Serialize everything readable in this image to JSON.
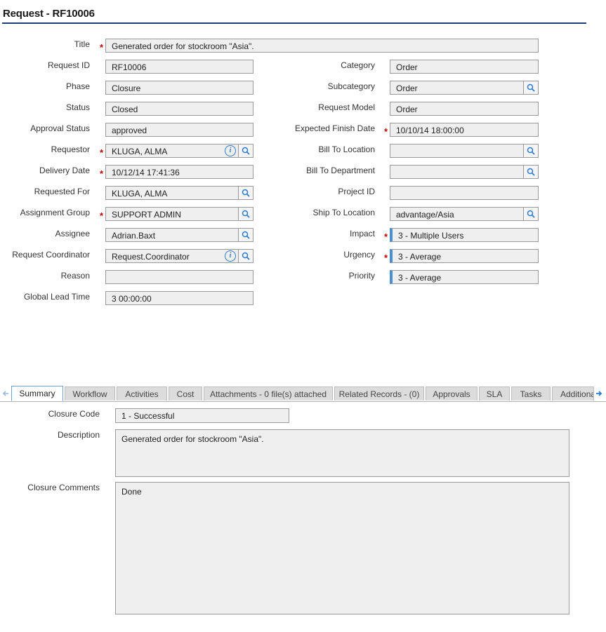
{
  "page": {
    "title": "Request - RF10006"
  },
  "form": {
    "title": {
      "label": "Title",
      "value": "Generated order for stockroom \"Asia\"."
    },
    "left": [
      {
        "label": "Request ID",
        "value": "RF10006"
      },
      {
        "label": "Phase",
        "value": "Closure"
      },
      {
        "label": "Status",
        "value": "Closed"
      },
      {
        "label": "Approval Status",
        "value": "approved"
      },
      {
        "label": "Requestor",
        "value": "KLUGA, ALMA"
      },
      {
        "label": "Delivery Date",
        "value": "10/12/14 17:41:36"
      },
      {
        "label": "Requested For",
        "value": "KLUGA, ALMA"
      },
      {
        "label": "Assignment Group",
        "value": "SUPPORT ADMIN"
      },
      {
        "label": "Assignee",
        "value": "Adrian.Baxt"
      },
      {
        "label": "Request Coordinator",
        "value": "Request.Coordinator"
      },
      {
        "label": "Reason",
        "value": ""
      },
      {
        "label": "Global Lead Time",
        "value": "3 00:00:00"
      }
    ],
    "right": [
      {
        "label": "Category",
        "value": "Order"
      },
      {
        "label": "Subcategory",
        "value": "Order"
      },
      {
        "label": "Request Model",
        "value": "Order"
      },
      {
        "label": "Expected Finish Date",
        "value": "10/10/14 18:00:00"
      },
      {
        "label": "Bill To Location",
        "value": ""
      },
      {
        "label": "Bill To Department",
        "value": ""
      },
      {
        "label": "Project ID",
        "value": ""
      },
      {
        "label": "Ship To Location",
        "value": "advantage/Asia"
      },
      {
        "label": "Impact",
        "value": "3 - Multiple Users"
      },
      {
        "label": "Urgency",
        "value": "3 - Average"
      },
      {
        "label": "Priority",
        "value": "3 - Average"
      }
    ]
  },
  "tabs": [
    "Summary",
    "Workflow",
    "Activities",
    "Cost",
    "Attachments - 0 file(s) attached",
    "Related Records - (0)",
    "Approvals",
    "SLA",
    "Tasks",
    "Additional"
  ],
  "summary": {
    "closure_code": {
      "label": "Closure Code",
      "value": "1 - Successful"
    },
    "description": {
      "label": "Description",
      "value": "Generated order for stockroom \"Asia\"."
    },
    "closure_comments": {
      "label": "Closure Comments",
      "value": "Done"
    }
  },
  "colors": {
    "accent": "#1f3f7a",
    "required": "#c00000",
    "priority_bar": "#4a8fd4",
    "field_bg": "#efefef"
  },
  "icons": {
    "lookup": "search-icon",
    "info": "info-icon",
    "scroll_left": "arrow-left-icon",
    "scroll_right": "arrow-right-icon"
  }
}
